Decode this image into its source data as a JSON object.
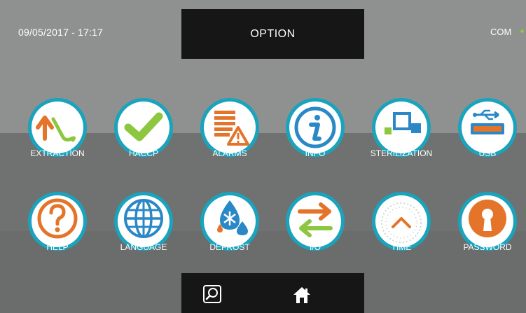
{
  "header": {
    "datetime": "09/05/2017 - 17:17",
    "title": "OPTION",
    "status_label": "COM",
    "status_color": "#8dc63f"
  },
  "colors": {
    "ring": "#1aa3bd",
    "orange": "#e3742a",
    "green": "#8dc63f",
    "blue": "#2a88c6"
  },
  "menu": {
    "row1": [
      {
        "label": "EXTRACTION",
        "icon": "extraction-icon"
      },
      {
        "label": "HACCP",
        "icon": "checkmark-icon"
      },
      {
        "label": "ALARMS",
        "icon": "alarm-warning-icon"
      },
      {
        "label": "INFO",
        "icon": "info-icon"
      },
      {
        "label": "STERILIZATION",
        "icon": "sterilization-icon"
      },
      {
        "label": "USB",
        "icon": "usb-icon"
      }
    ],
    "row2": [
      {
        "label": "HELP",
        "icon": "help-icon"
      },
      {
        "label": "LANGUAGE",
        "icon": "globe-icon"
      },
      {
        "label": "DEFROST",
        "icon": "defrost-icon"
      },
      {
        "label": "I/O",
        "icon": "input-output-icon"
      },
      {
        "label": "TIME",
        "icon": "clock-icon"
      },
      {
        "label": "PASSWORD",
        "icon": "keyhole-icon"
      }
    ]
  },
  "navbar": {
    "buttons": [
      {
        "icon": "search-icon"
      },
      {
        "icon": "home-icon"
      }
    ]
  }
}
